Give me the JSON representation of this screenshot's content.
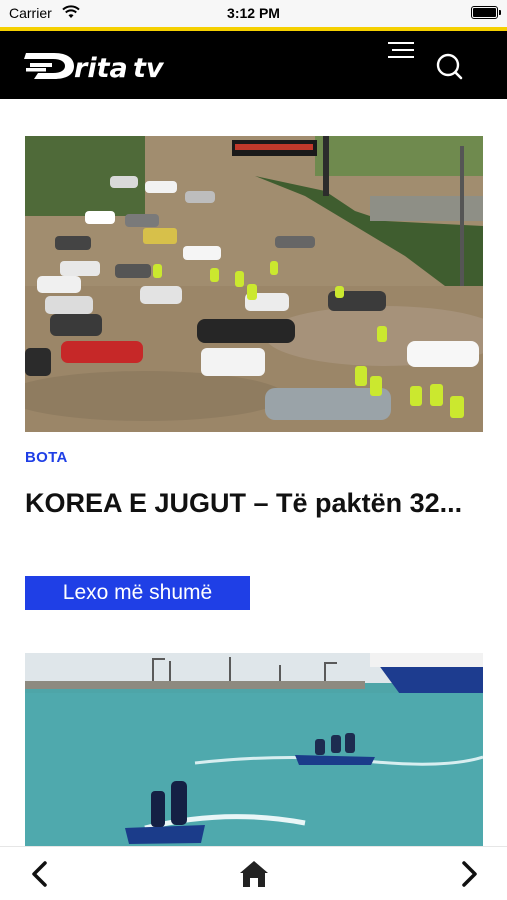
{
  "status_bar": {
    "carrier": "Carrier",
    "time": "3:12 PM"
  },
  "header": {
    "logo_text": "Dritatv",
    "menu_icon": "hamburger-menu-icon",
    "search_icon": "search-icon"
  },
  "articles": [
    {
      "image": "flood-street-photo",
      "category": "BOTA",
      "title": "KOREA E JUGUT – Të paktën 32...",
      "read_more_label": "Lexo më shumë"
    },
    {
      "image": "jet-ski-harbor-photo"
    }
  ],
  "bottom_nav": {
    "back_icon": "chevron-left-icon",
    "home_icon": "home-icon",
    "forward_icon": "chevron-right-icon"
  },
  "colors": {
    "accent": "#f5d000",
    "header_bg": "#000000",
    "link_blue": "#1f3fe6"
  }
}
